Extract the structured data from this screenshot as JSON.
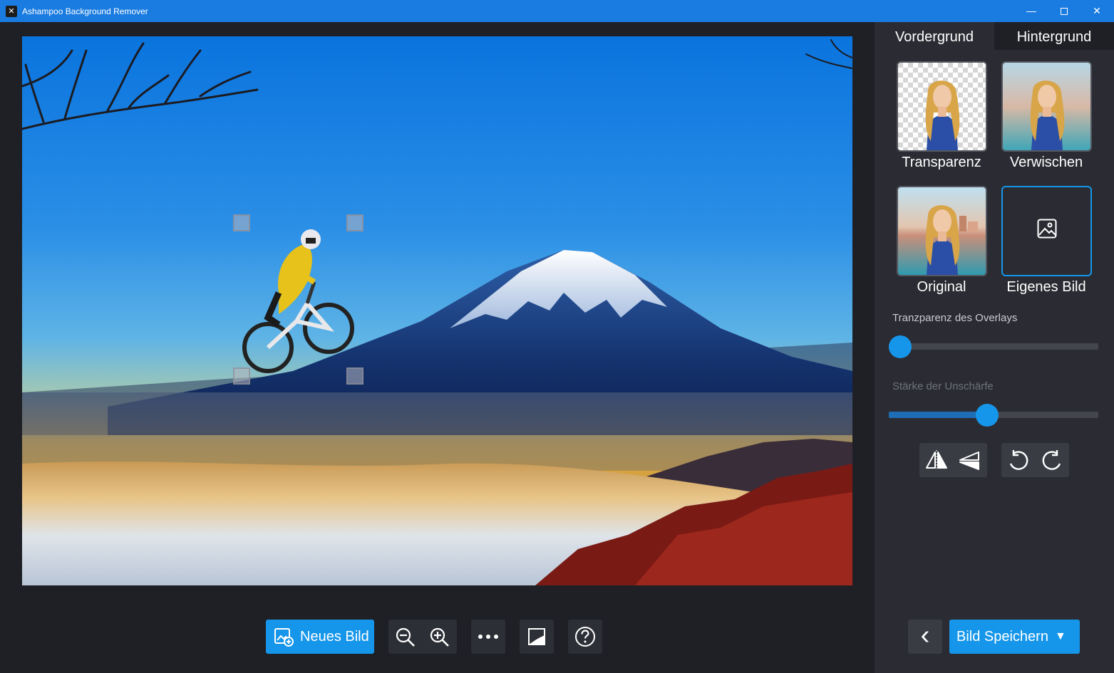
{
  "window": {
    "title": "Ashampoo Background Remover",
    "minimize_glyph": "—",
    "close_glyph": "✕",
    "app_icon_glyph": "✕"
  },
  "canvas": {
    "image_subject": "mountain-biker-over-mount-fuji"
  },
  "toolbar": {
    "new_image_label": "Neues Bild",
    "zoom_out_icon": "zoom-out-icon",
    "zoom_in_icon": "zoom-in-icon",
    "more_icon": "more-icon",
    "compare_icon": "compare-icon",
    "help_icon": "help-icon"
  },
  "panel": {
    "tabs": [
      {
        "label": "Vordergrund",
        "active": true
      },
      {
        "label": "Hintergrund",
        "active": false
      }
    ],
    "background_options": [
      {
        "label": "Transparenz",
        "selected": false
      },
      {
        "label": "Verwischen",
        "selected": false
      },
      {
        "label": "Original",
        "selected": false
      },
      {
        "label": "Eigenes Bild",
        "selected": true
      }
    ],
    "sliders": [
      {
        "label": "Tranzparenz des Overlays",
        "value": 0.0,
        "enabled": true
      },
      {
        "label": "Stärke der Unschärfe",
        "value": 0.47,
        "enabled": false
      }
    ],
    "back_glyph": "‹",
    "save_label": "Bild Speichern",
    "save_dropdown_glyph": "▼"
  },
  "colors": {
    "accent": "#1596ea",
    "titlebar": "#1a7ce0",
    "panel_bg": "#2b2c33",
    "workspace_bg": "#1f2025",
    "label_enabled": "#c9cbd1",
    "label_disabled": "#6f727a"
  }
}
